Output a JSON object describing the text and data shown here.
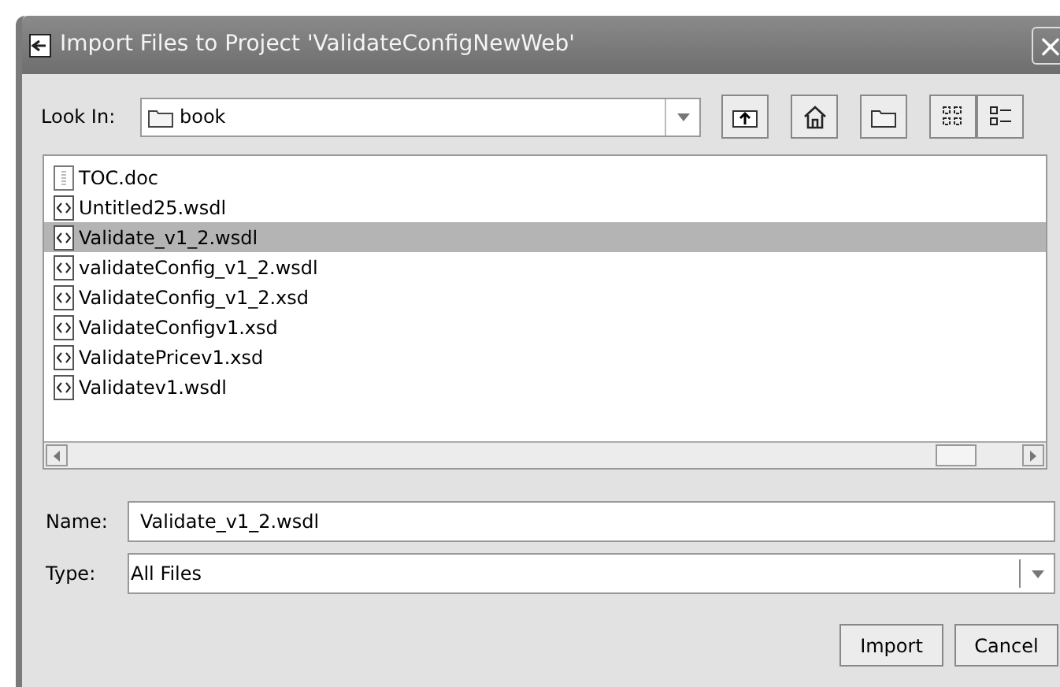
{
  "window": {
    "title": "Import Files to Project 'ValidateConfigNewWeb'",
    "close": "×"
  },
  "look_in": {
    "label": "Look In:",
    "value": "book"
  },
  "files": [
    {
      "name": "TOC.doc",
      "kind": "doc",
      "selected": false
    },
    {
      "name": "Untitled25.wsdl",
      "kind": "xml",
      "selected": false
    },
    {
      "name": "Validate_v1_2.wsdl",
      "kind": "xml",
      "selected": true
    },
    {
      "name": "validateConfig_v1_2.wsdl",
      "kind": "xml",
      "selected": false
    },
    {
      "name": "ValidateConfig_v1_2.xsd",
      "kind": "xml",
      "selected": false
    },
    {
      "name": "ValidateConfigv1.xsd",
      "kind": "xml",
      "selected": false
    },
    {
      "name": "ValidatePricev1.xsd",
      "kind": "xml",
      "selected": false
    },
    {
      "name": "Validatev1.wsdl",
      "kind": "xml",
      "selected": false
    }
  ],
  "name_field": {
    "label": "Name:",
    "value": "Validate_v1_2.wsdl"
  },
  "type_field": {
    "label": "Type:",
    "value": "All Files"
  },
  "buttons": [
    "Import",
    "Cancel"
  ]
}
